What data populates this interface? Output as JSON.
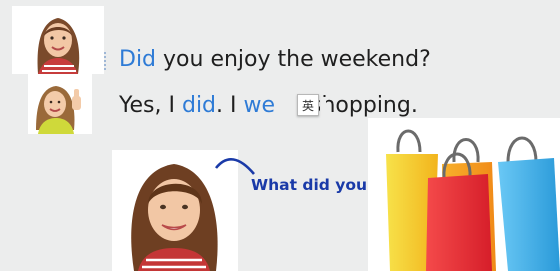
{
  "slide": {
    "line1": {
      "did": "Did",
      "rest": " you enjoy the weekend?"
    },
    "line2": {
      "yes": "Yes, I ",
      "did": "did",
      "mid": ". I ",
      "went_partial": "we",
      "dict_char": "英",
      "rest": " shopping."
    },
    "question": "What did you do?"
  },
  "photos": [
    {
      "name": "girl smiling (small)"
    },
    {
      "name": "girl thumbs up"
    },
    {
      "name": "girl smiling (large)"
    }
  ],
  "colors": {
    "background": "#eceded",
    "blue_text": "#2e7bd6",
    "question_text": "#1a3aa8",
    "arc": "#1a3aa8"
  },
  "icons": [
    "dictionary-icon",
    "shopping-bags-icon"
  ]
}
